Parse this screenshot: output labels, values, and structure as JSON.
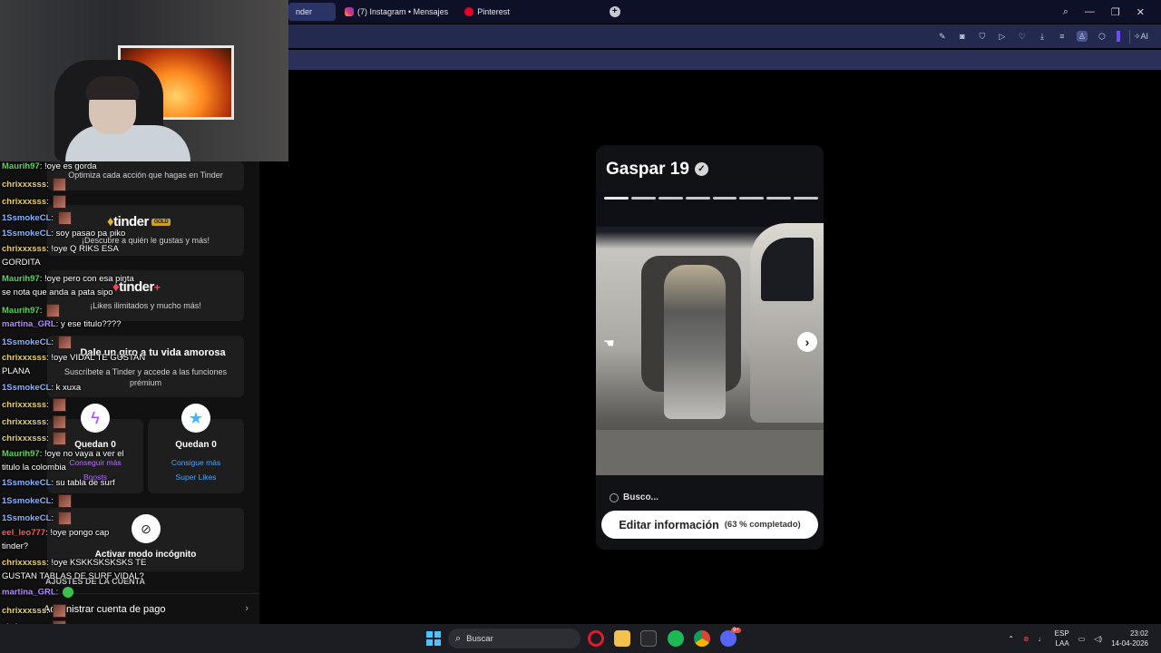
{
  "browser": {
    "tabs": [
      {
        "label": "nder",
        "active": true
      },
      {
        "label": "(7) Instagram • Mensajes",
        "active": false
      },
      {
        "label": "Pinterest",
        "active": false
      }
    ],
    "new_tab": "+",
    "ai_label": "AI"
  },
  "sidebar": {
    "optimize_text": "Optimiza cada acción que hagas en Tinder",
    "gold_logo": "tinder",
    "gold_badge": "GOLD",
    "gold_text": "¡Descubre a quién le gustas y más!",
    "plus_logo": "tinder",
    "plus_mark": "+",
    "plus_text": "¡Likes ilimitados y mucho más!",
    "premium_title": "Dale un giro a tu vida amorosa",
    "premium_text": "Suscríbete a Tinder y accede a las funciones prémium",
    "boosts": {
      "count": "Quedan 0",
      "link1": "Conseguir más",
      "link2": "Boosts"
    },
    "superlikes": {
      "count": "Quedan 0",
      "link1": "Consigue más",
      "link2": "Super Likes"
    },
    "incognito": "Activar modo incógnito",
    "account_section": "AJUSTES DE LA CUENTA",
    "manage_payment": "Administrar cuenta de pago"
  },
  "chat": [
    {
      "user": "Maurih97",
      "color": "#5fd35f",
      "text": "!oye es gorda"
    },
    {
      "user": "chrixxxsss",
      "color": "#e7d36a",
      "text": ""
    },
    {
      "user": "chrixxxsss",
      "color": "#e7d36a",
      "text": ""
    },
    {
      "user": "1SsmokeCL",
      "color": "#8ab4ff",
      "text": ""
    },
    {
      "user": "1SsmokeCL",
      "color": "#8ab4ff",
      "text": "soy pasao pa piko"
    },
    {
      "user": "chrixxxsss",
      "color": "#e7d36a",
      "text": "!oye Q RIKS ESA"
    },
    {
      "user": "",
      "color": "#fff",
      "text": "GORDITA"
    },
    {
      "user": "Maurih97",
      "color": "#5fd35f",
      "text": "!oye pero con esa pinta"
    },
    {
      "user": "",
      "color": "#fff",
      "text": "se nota que anda a pata sipo"
    },
    {
      "user": "Maurih97",
      "color": "#5fd35f",
      "text": ""
    },
    {
      "user": "martina_GRL",
      "color": "#b18cff",
      "text": "y ese titulo????"
    },
    {
      "user": "1SsmokeCL",
      "color": "#8ab4ff",
      "text": ""
    },
    {
      "user": "chrixxxsss",
      "color": "#e7d36a",
      "text": "!oye VIDAL TE GUSTAN"
    },
    {
      "user": "",
      "color": "#fff",
      "text": "PLANA"
    },
    {
      "user": "1SsmokeCL",
      "color": "#8ab4ff",
      "text": "k xuxa"
    },
    {
      "user": "chrixxxsss",
      "color": "#e7d36a",
      "text": ""
    },
    {
      "user": "chrixxxsss",
      "color": "#e7d36a",
      "text": ""
    },
    {
      "user": "chrixxxsss",
      "color": "#e7d36a",
      "text": ""
    },
    {
      "user": "Maurih97",
      "color": "#5fd35f",
      "text": "!oye no vaya a ver el"
    },
    {
      "user": "",
      "color": "#fff",
      "text": "titulo la colombia"
    },
    {
      "user": "1SsmokeCL",
      "color": "#8ab4ff",
      "text": "su tabla de surf"
    },
    {
      "user": "1SsmokeCL",
      "color": "#8ab4ff",
      "text": ""
    },
    {
      "user": "1SsmokeCL",
      "color": "#8ab4ff",
      "text": ""
    },
    {
      "user": "eel_leo777",
      "color": "#ff5a5a",
      "text": "!oye pongo cap"
    },
    {
      "user": "",
      "color": "#fff",
      "text": "tinder?"
    },
    {
      "user": "chrixxxsss",
      "color": "#e7d36a",
      "text": "!oye KSKKSKSKSKS TE"
    },
    {
      "user": "",
      "color": "#fff",
      "text": "GUSTAN TABLAS DE SURF VIDAL?"
    },
    {
      "user": "martina_GRL",
      "color": "#b18cff",
      "text": ""
    },
    {
      "user": "chrixxxsss",
      "color": "#e7d36a",
      "text": ""
    },
    {
      "user": "chrixxxsss",
      "color": "#e7d36a",
      "text": ""
    },
    {
      "user": "chrixxxsss",
      "color": "#e7d36a",
      "text": ""
    }
  ],
  "profile": {
    "name": "Gaspar",
    "age": "19",
    "verified_mark": "✓",
    "photo_count": 8,
    "current_photo": 1,
    "search_label": "Busco...",
    "edit_label": "Editar información",
    "completion": "(63 % completado)"
  },
  "taskbar": {
    "search_placeholder": "Buscar",
    "lang1": "ESP",
    "lang2": "LAA",
    "time": "23:02",
    "date": "14-04-2026",
    "discord_badge": "9+"
  },
  "colors": {
    "accent_boost": "#a64dff",
    "accent_superlike": "#3fb6ff",
    "link_superlike": "#4aa3ff",
    "link_boost": "#b56cff",
    "tab_active_bg": "#2c3466"
  }
}
